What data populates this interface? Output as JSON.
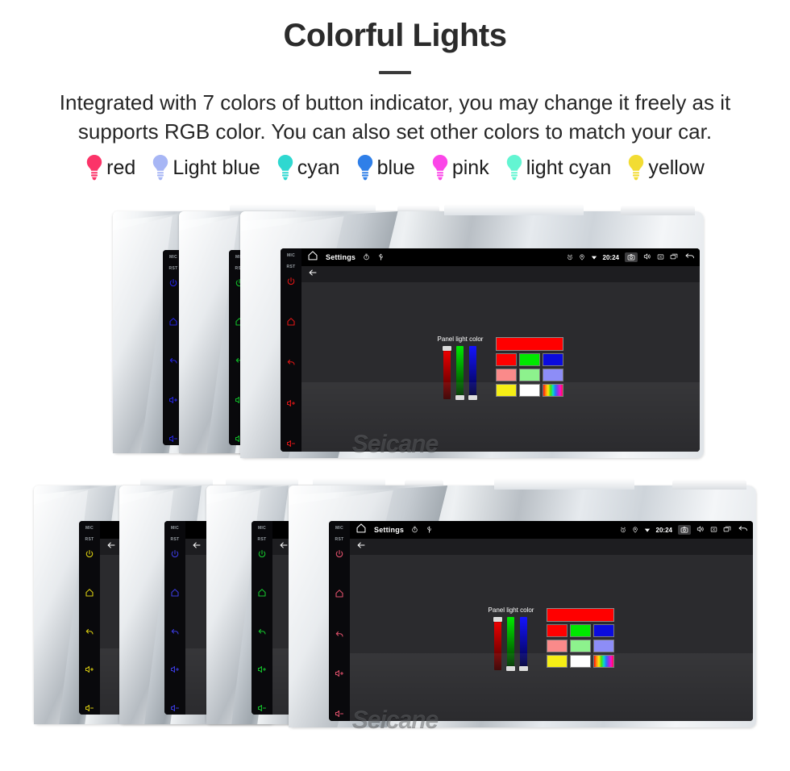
{
  "header": {
    "title": "Colorful Lights",
    "subtitle": "Integrated with 7 colors of button indicator, you may change it freely as it supports RGB color. You can also set other colors to match your car."
  },
  "legend": {
    "items": [
      {
        "label": "red",
        "color": "#fb3468",
        "icon": "light-bulb-icon"
      },
      {
        "label": "Light blue",
        "color": "#a7b6f5",
        "icon": "light-bulb-icon"
      },
      {
        "label": "cyan",
        "color": "#2fd8d0",
        "icon": "light-bulb-icon"
      },
      {
        "label": "blue",
        "color": "#2f7fe8",
        "icon": "light-bulb-icon"
      },
      {
        "label": "pink",
        "color": "#fb46e8",
        "icon": "light-bulb-icon"
      },
      {
        "label": "light cyan",
        "color": "#63f5d2",
        "icon": "light-bulb-icon"
      },
      {
        "label": "yellow",
        "color": "#f2dc33",
        "icon": "light-bulb-icon"
      }
    ]
  },
  "device": {
    "keys": {
      "mic_label": "MIC",
      "rst_label": "RST",
      "icons": [
        "power-icon",
        "home-icon",
        "back-icon",
        "volume-up-icon",
        "volume-down-icon"
      ]
    },
    "statusbar": {
      "home_icon": "home-icon",
      "title": "Settings",
      "timer_icon": "timer-icon",
      "usb_icon": "usb-icon",
      "alarm_icon": "alarm-icon",
      "location_icon": "location-pin-icon",
      "wifi_icon": "wifi-icon",
      "time": "20:24",
      "camera_icon": "camera-icon",
      "volume_icon": "volume-icon",
      "close_icon": "close-box-icon",
      "recents_icon": "recents-icon",
      "back_icon": "back-arrow-icon"
    },
    "actionbar": {
      "back_icon": "back-arrow-icon"
    },
    "panel": {
      "label": "Panel light color",
      "sliders": [
        {
          "name": "red",
          "value": 100,
          "gradient": "#ff0000"
        },
        {
          "name": "green",
          "value": 0,
          "gradient": "#00e800"
        },
        {
          "name": "blue",
          "value": 0,
          "gradient": "#1414ff"
        }
      ],
      "preview_color": "#ff0000",
      "swatch_rows": [
        [
          "#ff0000",
          "#00e800",
          "#0b0bdd"
        ],
        [
          "#fa8a8a",
          "#8df28d",
          "#8d8df7"
        ],
        [
          "#f5ed0a",
          "#ffffff",
          "rainbow"
        ]
      ]
    },
    "watermark": "Seicane"
  },
  "rows": [
    {
      "name": "row-top",
      "units": [
        {
          "key_color": "#2323dd",
          "screen": false
        },
        {
          "key_color": "#0fbd28",
          "screen": false
        },
        {
          "key_color": "#dd1515",
          "screen": "full"
        }
      ]
    },
    {
      "name": "row-bottom",
      "units": [
        {
          "key_color": "#d8cc10",
          "screen": "partial"
        },
        {
          "key_color": "#3a3add",
          "screen": "partial"
        },
        {
          "key_color": "#15c22c",
          "screen": "partial"
        },
        {
          "key_color": "#e0506b",
          "screen": "full"
        }
      ]
    }
  ]
}
